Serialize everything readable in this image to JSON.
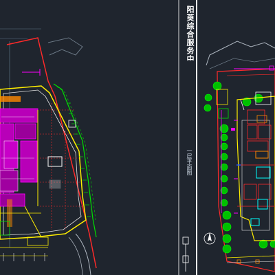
{
  "viewport": {
    "background": "#1f252e",
    "divider_color": "#f2f2f2",
    "colors": {
      "boundary": "#ff2a2a",
      "magenta": "#ff00ff",
      "yellow": "#ffee00",
      "green": "#00e000",
      "cyan": "#00ffff",
      "white": "#ffffff",
      "orange": "#ff8800",
      "grey": "#aeb6c0",
      "blue": "#2255ff"
    }
  },
  "title_block": {
    "project_title": "阳萸综合服务中心",
    "drawing_label": "一层平面图"
  },
  "icons": {
    "north_arrow": "north-arrow-icon",
    "trees": "tree-icon"
  }
}
